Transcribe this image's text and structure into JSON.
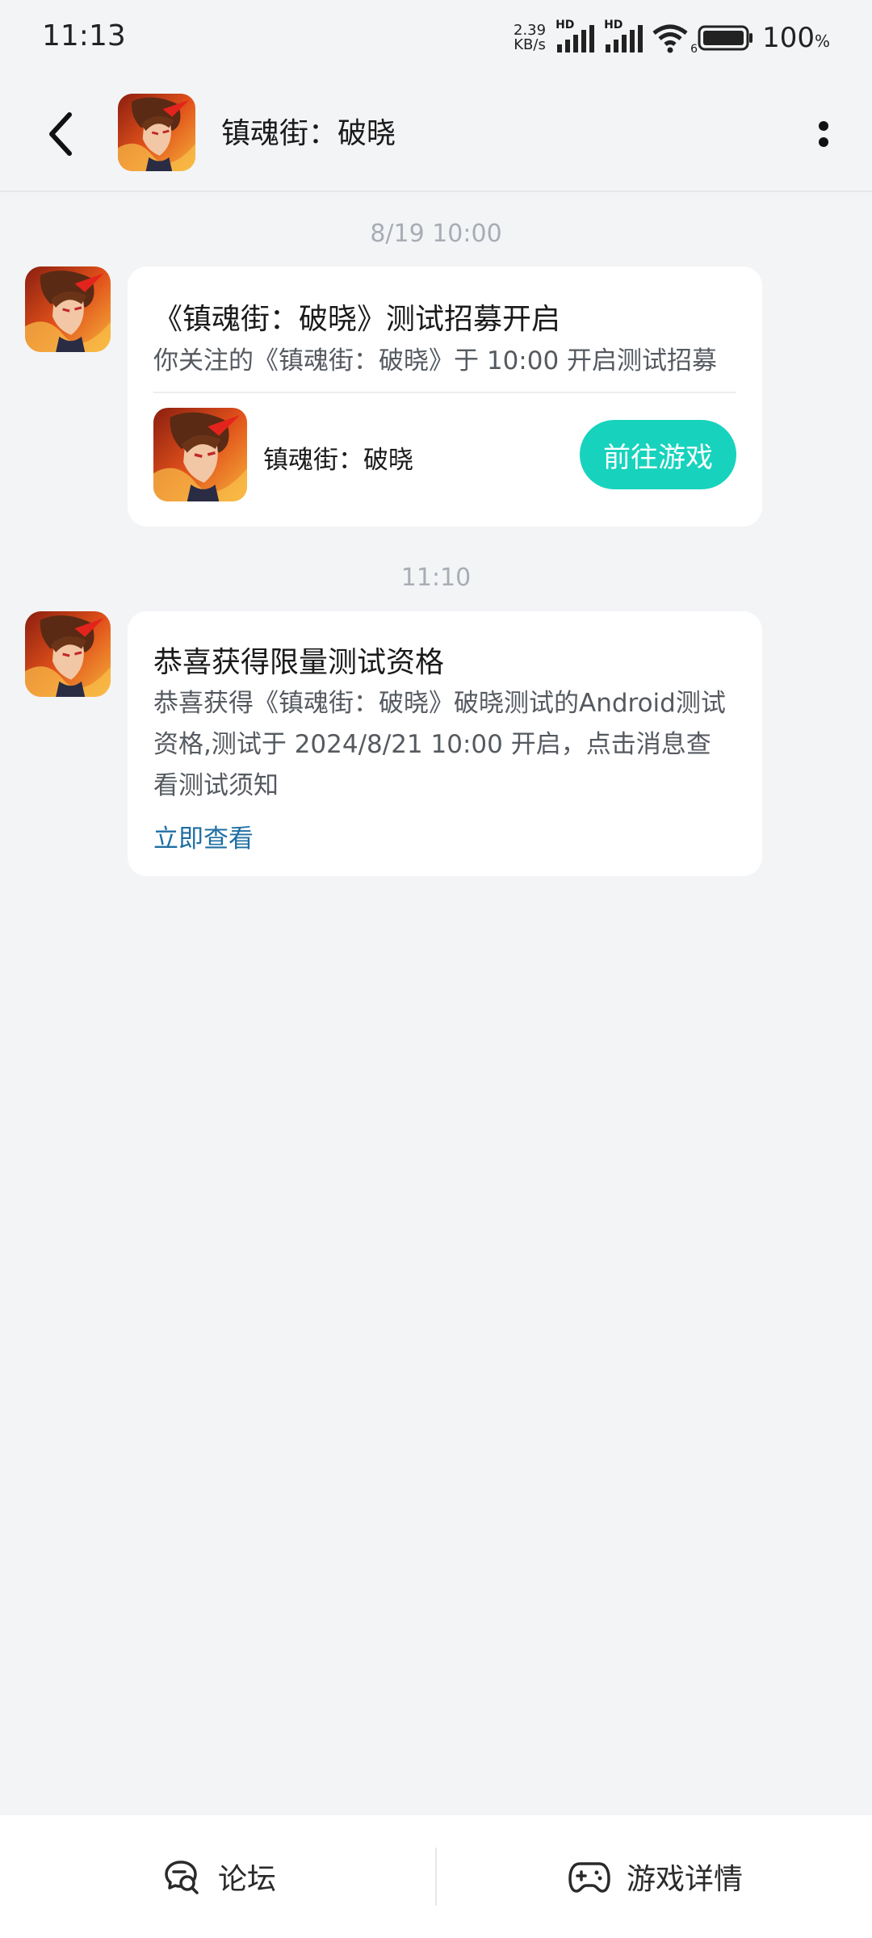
{
  "status_bar": {
    "time": "11:13",
    "net_speed_value": "2.39",
    "net_speed_unit": "KB/s",
    "battery_percent": "100",
    "battery_unit": "%",
    "signal_label_1": "HD",
    "signal_label_2": "HD",
    "wifi_label": "6"
  },
  "header": {
    "title": "镇魂街：破晓",
    "avatar_icon": "game-avatar-icon",
    "back_icon": "back-arrow-icon",
    "more_icon": "more-vertical-icon"
  },
  "messages": [
    {
      "time": "8/19  10:00",
      "title": "《镇魂街：破晓》测试招募开启",
      "desc": "你关注的《镇魂街：破晓》于 10:00 开启测试招募",
      "game_name": "镇魂街：破晓",
      "button_label": "前往游戏"
    },
    {
      "time": "11:10",
      "title": "恭喜获得限量测试资格",
      "desc": "恭喜获得《镇魂街：破晓》破晓测试的Android测试资格,测试于 2024/8/21 10:00 开启，点击消息查看测试须知",
      "link_label": "立即查看"
    }
  ],
  "bottom_nav": {
    "forum_label": "论坛",
    "details_label": "游戏详情",
    "forum_icon": "forum-chat-icon",
    "details_icon": "gamepad-icon"
  },
  "colors": {
    "background": "#f3f4f6",
    "card": "#ffffff",
    "accent_button": "#17d3bd",
    "link": "#1f6fa3",
    "timestamp": "#a8adb5"
  }
}
